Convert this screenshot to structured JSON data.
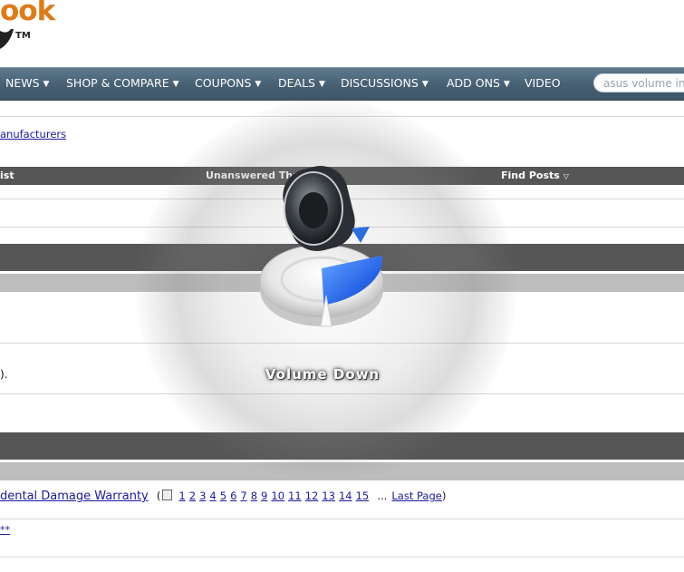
{
  "header": {
    "logo_text": "ook",
    "logo_tm": "TM"
  },
  "nav": {
    "items": [
      {
        "label": "NEWS"
      },
      {
        "label": "SHOP & COMPARE"
      },
      {
        "label": "COUPONS"
      },
      {
        "label": "DEALS"
      },
      {
        "label": "DISCUSSIONS"
      },
      {
        "label": "ADD ONS"
      },
      {
        "label": "VIDEO"
      }
    ],
    "search_text": "asus volume inc"
  },
  "breadcrumb": {
    "link": "anufacturers"
  },
  "forum_header": {
    "left": "ist",
    "middle": "Unanswered Thre",
    "right": "Find Posts"
  },
  "thread": {
    "line1_suffix": ").",
    "title": "dental Damage Warranty",
    "pages": [
      "1",
      "2",
      "3",
      "4",
      "5",
      "6",
      "7",
      "8",
      "9",
      "10",
      "11",
      "12",
      "13",
      "14",
      "15"
    ],
    "ellipsis": "...",
    "last_page": "Last Page",
    "close_paren": ")",
    "open_paren": "(",
    "small_link": "**"
  },
  "osd": {
    "label": "Volume Down",
    "volume_fraction": 0.25
  },
  "colors": {
    "accent_orange": "#e07a16",
    "nav_bar": "#4b6477",
    "volume_blue": "#1a5ee8"
  }
}
